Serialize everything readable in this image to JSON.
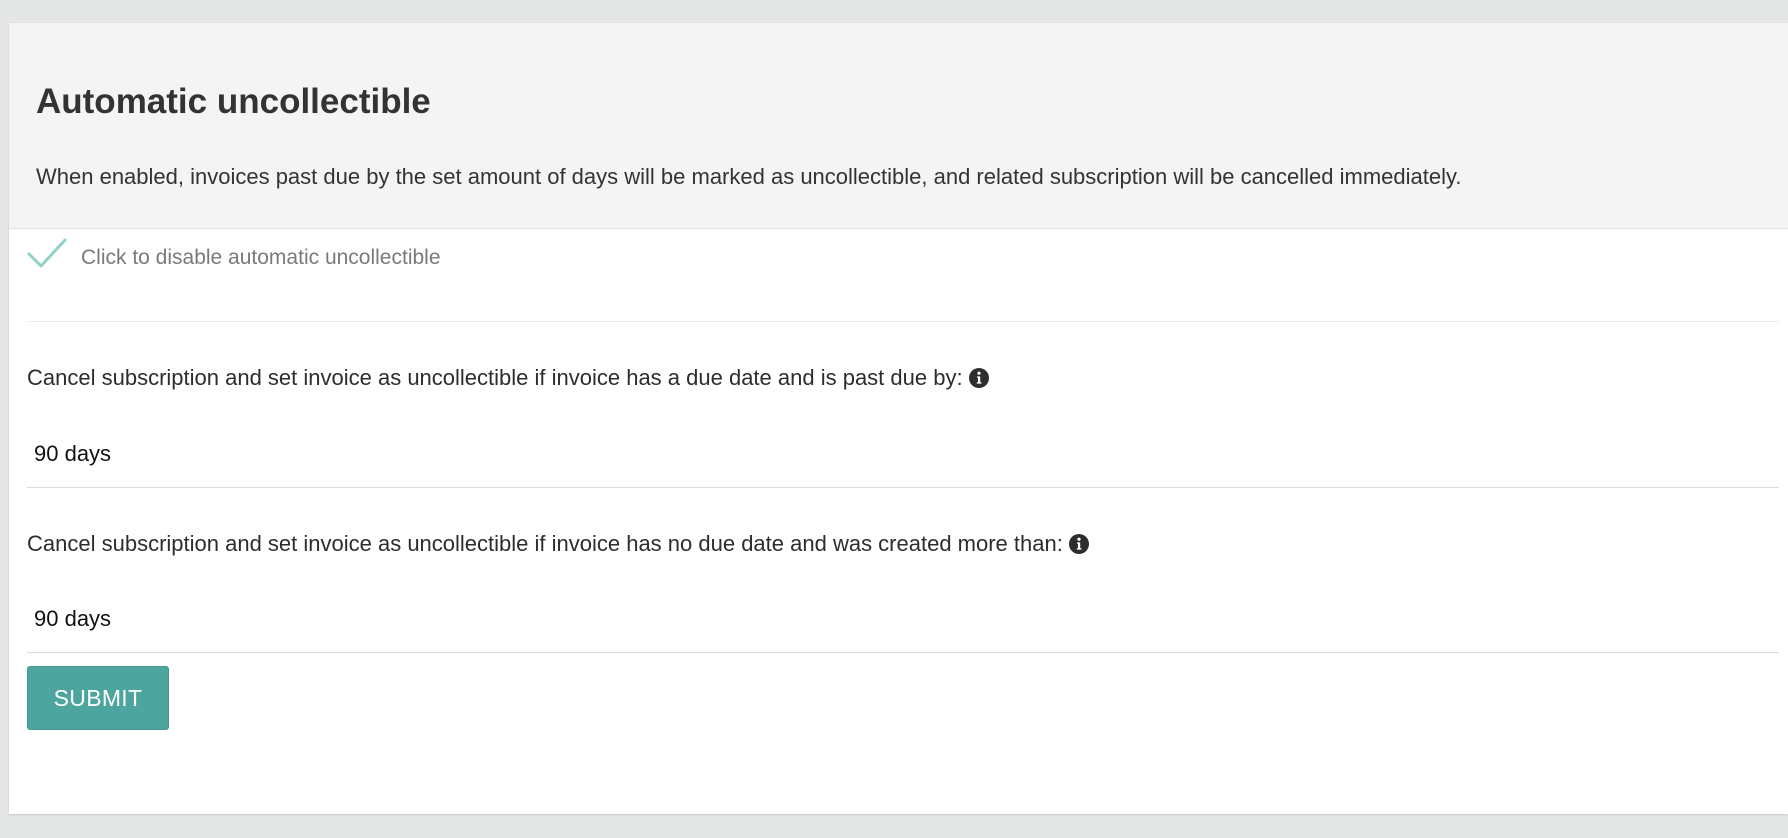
{
  "section": {
    "title": "Automatic uncollectible",
    "description": "When enabled, invoices past due by the set amount of days will be marked as uncollectible, and related subscription will be cancelled immediately."
  },
  "toggle": {
    "label": "Click to disable automatic uncollectible",
    "checked": true,
    "icon": "checkmark-icon",
    "color": "#8fd0c9"
  },
  "fields": [
    {
      "label": "Cancel subscription and set invoice as uncollectible if invoice has a due date and is past due by:",
      "value": "90 days",
      "icon": "info-icon"
    },
    {
      "label": "Cancel subscription and set invoice as uncollectible if invoice has no due date and was created more than:",
      "value": "90 days",
      "icon": "info-icon"
    }
  ],
  "actions": {
    "submit_label": "SUBMIT"
  },
  "colors": {
    "accent": "#4ca69f",
    "header_bg": "#f4f4f4",
    "page_bg": "#e4e6e5"
  }
}
